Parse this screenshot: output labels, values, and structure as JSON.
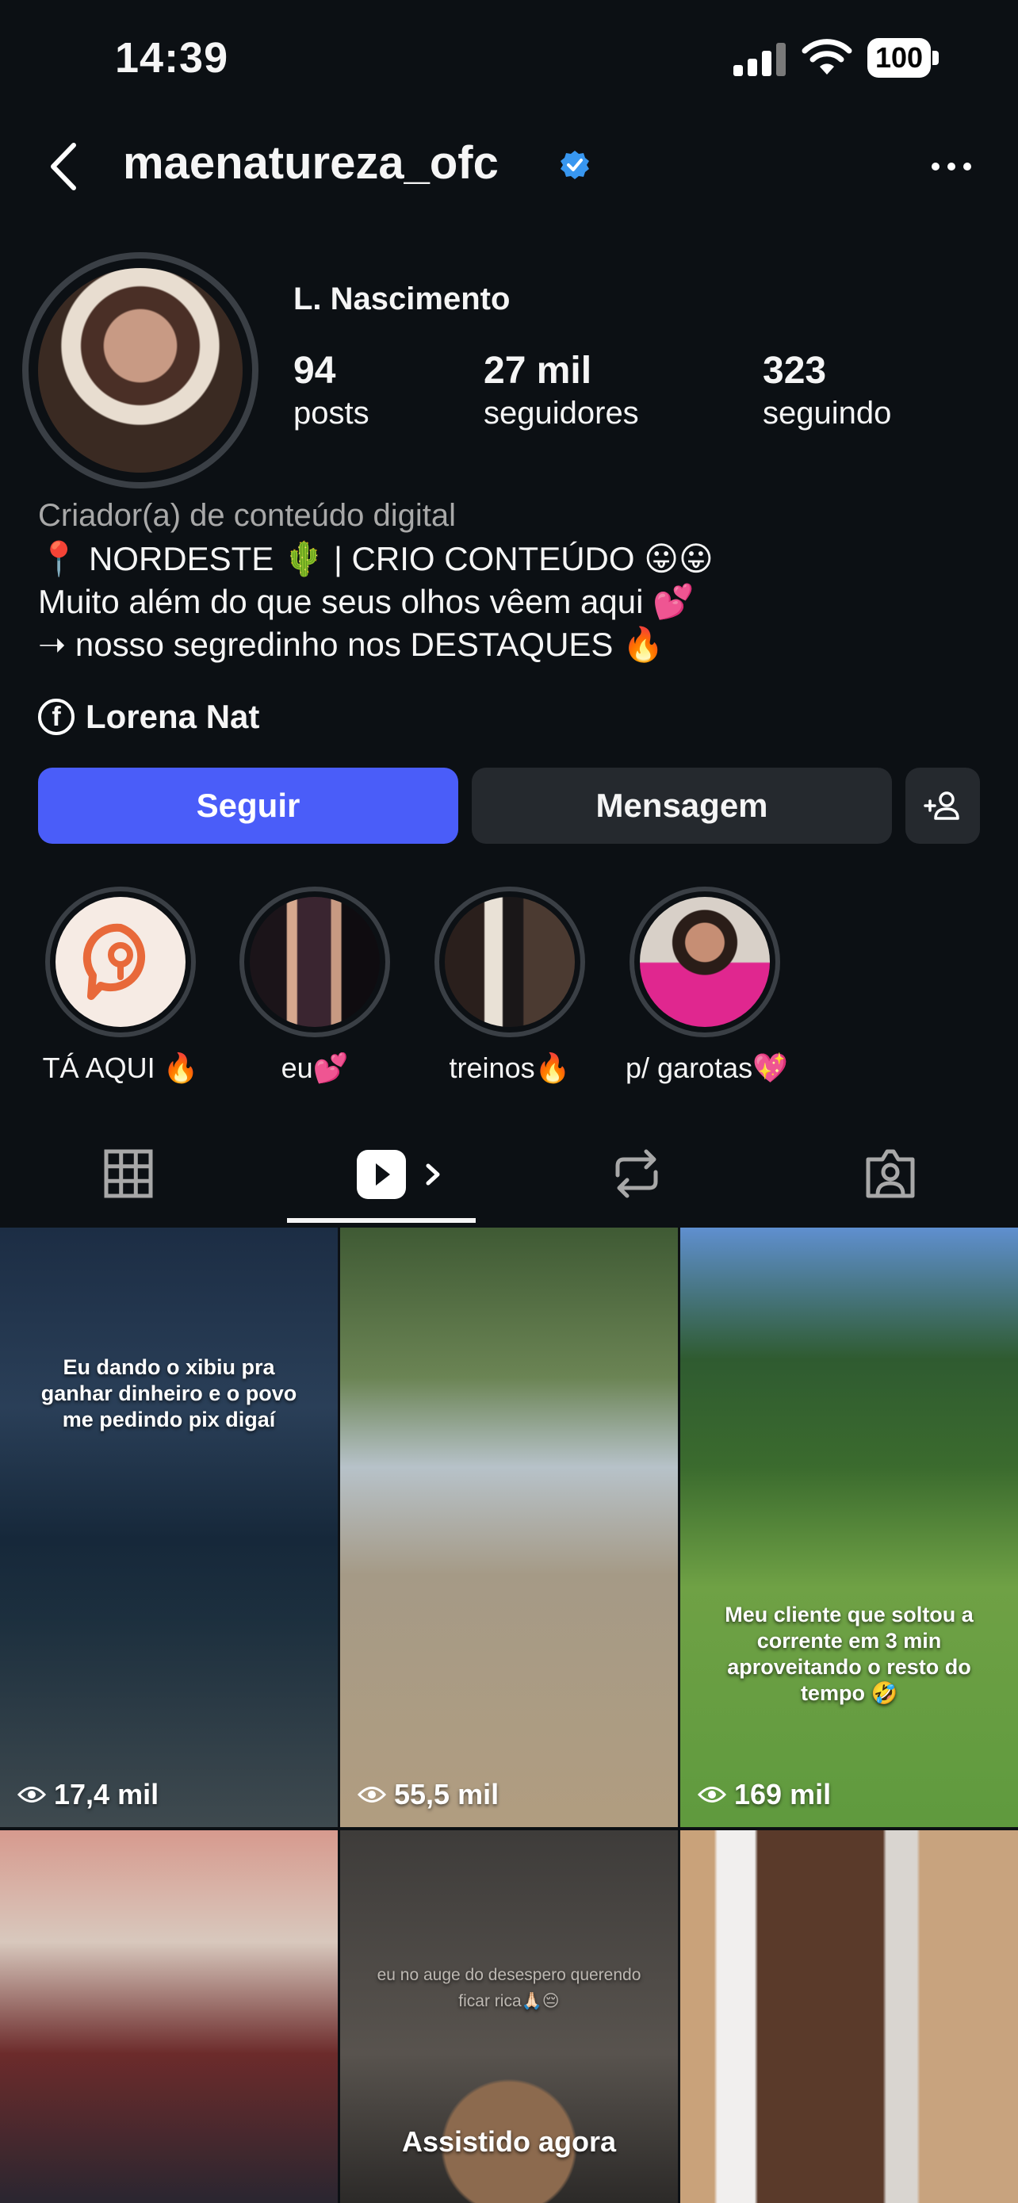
{
  "status_bar": {
    "time": "14:39",
    "battery": "100"
  },
  "header": {
    "username": "maenatureza_ofc"
  },
  "profile": {
    "display_name": "L. Nascimento",
    "stats": [
      {
        "value": "94",
        "label": "posts"
      },
      {
        "value": "27 mil",
        "label": "seguidores"
      },
      {
        "value": "323",
        "label": "seguindo"
      }
    ],
    "category": "Criador(a) de conteúdo digital",
    "bio_lines": [
      "📍 NORDESTE 🌵 | CRIO CONTEÚDO 😛😛",
      "Muito além do que seus olhos vêem aqui 💕",
      "➝ nosso segredinho nos DESTAQUES 🔥"
    ],
    "facebook_link": "Lorena Nat"
  },
  "actions": {
    "follow": "Seguir",
    "message": "Mensagem"
  },
  "highlights": [
    {
      "label": "TÁ AQUI 🔥"
    },
    {
      "label": "eu💕"
    },
    {
      "label": "treinos🔥"
    },
    {
      "label": "p/ garotas💖"
    }
  ],
  "tabs": [
    "grid-icon",
    "reels-icon",
    "reposts-icon",
    "tagged-icon"
  ],
  "reels": [
    {
      "caption": "Eu dando o xibiu pra ganhar dinheiro e o povo me pedindo pix digaí",
      "views": "17,4 mil"
    },
    {
      "caption": "",
      "views": "55,5 mil"
    },
    {
      "caption": "Meu cliente que soltou a corrente em 3 min aproveitando o resto do tempo 🤣",
      "views": "169 mil"
    },
    {
      "caption": "",
      "views": ""
    },
    {
      "caption": "eu no auge do desespero querendo ficar rica🙏🏻😔",
      "overlay": "Assistido agora"
    },
    {
      "caption": "",
      "views": ""
    }
  ],
  "colors": {
    "background": "#0c1014",
    "accent": "#4a5df9",
    "button_secondary": "#25292e",
    "verified": "#3897f0"
  }
}
